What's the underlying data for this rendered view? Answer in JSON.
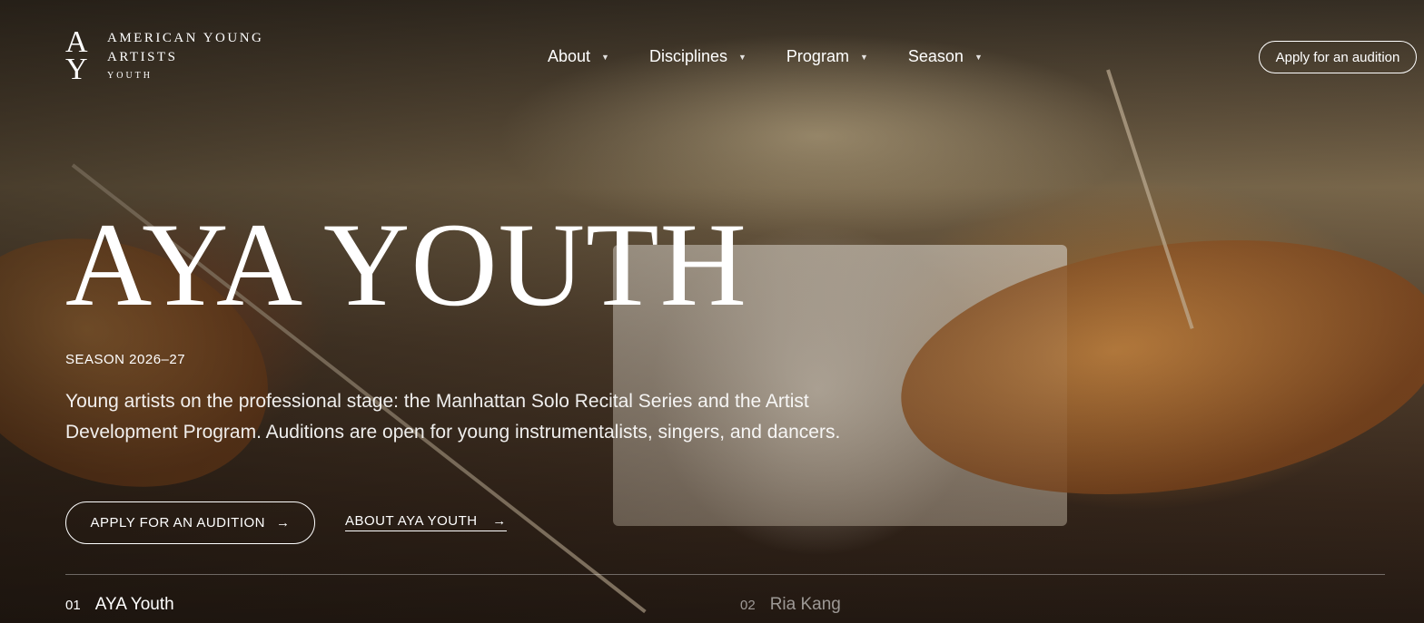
{
  "brand": {
    "mark_top": "A",
    "mark_bottom": "Y",
    "line1": "AMERICAN YOUNG",
    "line2": "ARTISTS",
    "line3": "YOUTH"
  },
  "nav": {
    "items": [
      {
        "label": "About"
      },
      {
        "label": "Disciplines"
      },
      {
        "label": "Program"
      },
      {
        "label": "Season"
      }
    ],
    "cta_label": "Apply for an audition"
  },
  "hero": {
    "title": "AYA YOUTH",
    "season": "SEASON 2026–27",
    "lede": "Young artists on the professional stage: the Manhattan Solo Recital Series and the Artist Development Program. Auditions are open for young instrumentalists, singers, and dancers.",
    "primary_cta": "APPLY FOR AN AUDITION",
    "secondary_cta": "ABOUT AYA YOUTH",
    "arrow": "→"
  },
  "slides": [
    {
      "num": "01",
      "name": "AYA Youth",
      "active": true
    },
    {
      "num": "02",
      "name": "Ria Kang",
      "active": false
    }
  ],
  "icons": {
    "chevron": "chevron-down-icon",
    "arrow": "arrow-right-icon"
  }
}
